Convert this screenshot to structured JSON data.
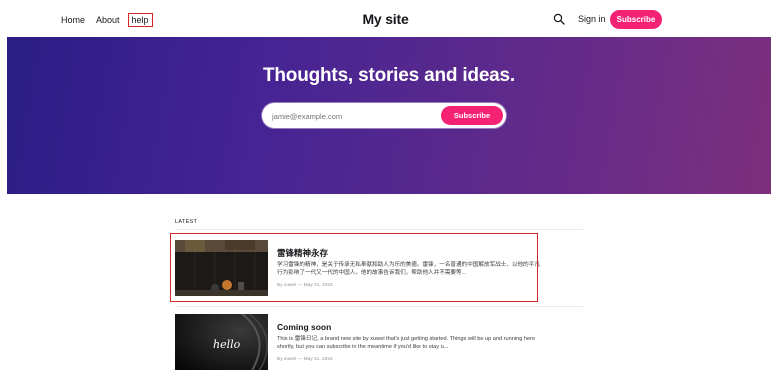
{
  "header": {
    "nav": [
      {
        "label": "Home"
      },
      {
        "label": "About"
      },
      {
        "label": "help"
      }
    ],
    "site_title": "My site",
    "sign_in": "Sign in",
    "subscribe": "Subscribe"
  },
  "hero": {
    "title": "Thoughts, stories and ideas.",
    "email_placeholder": "jamie@example.com",
    "subscribe": "Subscribe"
  },
  "feed": {
    "section_label": "LATEST",
    "posts": [
      {
        "title": "雷锋精神永存",
        "excerpt": "学习雷锋的精神，是关于传承无私奉献和助人为乐的美德。雷锋，一名普通的中国解放军战士，以他的平凡行为影响了一代又一代的中国人。他的故事告诉我们，帮助他人并不需要等...",
        "meta": "By xuwei — May 31, 2024"
      },
      {
        "title": "Coming soon",
        "excerpt": "This is 雷锋日记, a brand new site by xuwei that's just getting started. Things will be up and running here shortly, but you can subscribe in the meantime if you'd like to stay u...",
        "meta": "By xuwei — May 31, 2024",
        "thumb_text": "hello"
      }
    ]
  },
  "colors": {
    "accent": "#f42272",
    "hero_start": "#2a1d84",
    "hero_end": "#7d2f7d",
    "highlight": "#d7262a"
  }
}
